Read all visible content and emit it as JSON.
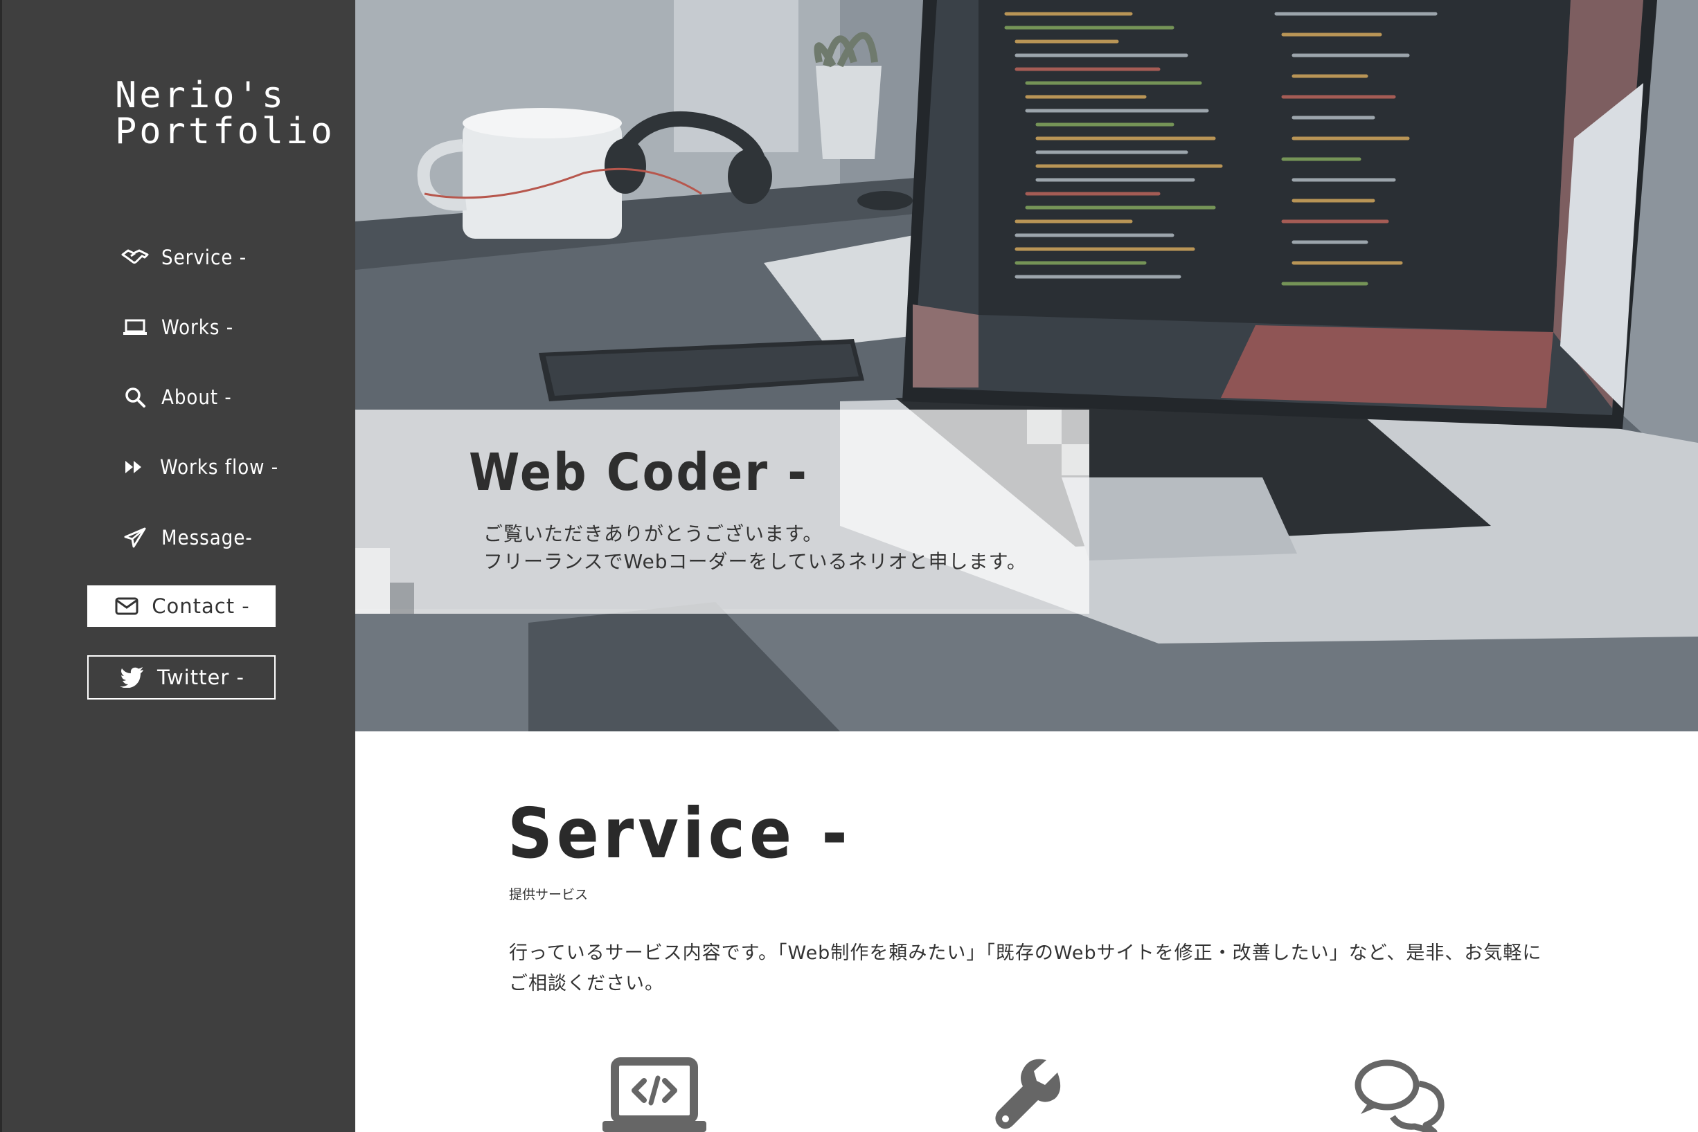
{
  "sidebar": {
    "logo_line1": "Nerio's",
    "logo_line2": "Portfolio",
    "items": [
      {
        "label": "Service -",
        "icon": "handshake-icon"
      },
      {
        "label": "Works -",
        "icon": "laptop-icon"
      },
      {
        "label": "About -",
        "icon": "search-icon"
      },
      {
        "label": "Works flow -",
        "icon": "fast-forward-icon"
      },
      {
        "label": "Message-",
        "icon": "paper-plane-icon"
      }
    ],
    "contact_label": "Contact -",
    "twitter_label": "Twitter -"
  },
  "hero": {
    "title": "Web Coder -",
    "line1": "ご覧いただきありがとうございます。",
    "line2": "フリーランスでWebコーダーをしているネリオと申します。"
  },
  "service": {
    "title": "Service -",
    "subtitle": "提供サービス",
    "description": "行っているサービス内容です。「Web制作を頼みたい」「既存のWebサイトを修正・改善したい」など、是非、お気軽にご相談ください。",
    "icons": [
      "code-laptop-icon",
      "wrench-icon",
      "chat-bubbles-icon"
    ]
  },
  "colors": {
    "sidebar_bg": "#3f3f3f",
    "text_dark": "#2a2a2a",
    "icon_gray": "#666666"
  }
}
